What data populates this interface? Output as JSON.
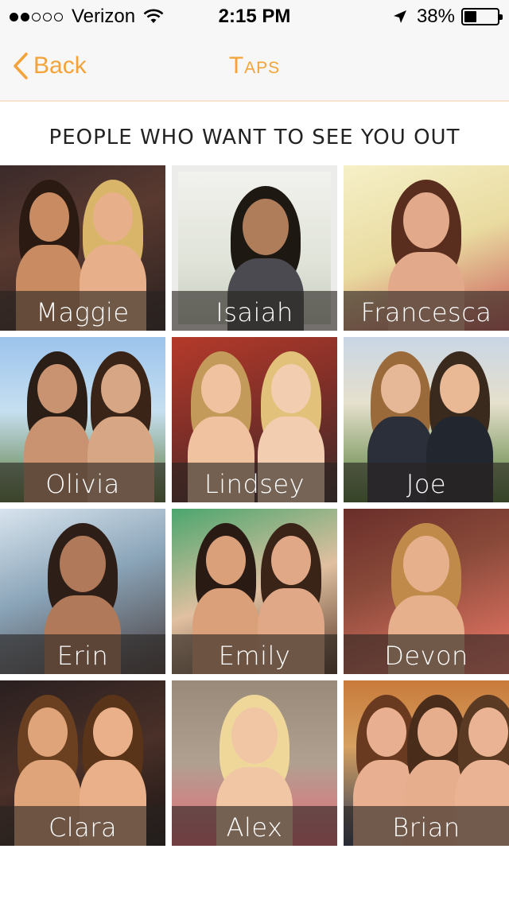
{
  "status_bar": {
    "carrier": "Verizon",
    "signal_bars_filled": 2,
    "signal_bars_total": 5,
    "time": "2:15 PM",
    "battery_percent": "38%",
    "battery_level": 0.38
  },
  "nav": {
    "back_label": "Back",
    "title": "Taps",
    "accent_color": "#f3a339"
  },
  "section": {
    "heading": "PEOPLE WHO WANT TO SEE YOU OUT"
  },
  "people": [
    {
      "name": "Maggie"
    },
    {
      "name": "Isaiah"
    },
    {
      "name": "Francesca"
    },
    {
      "name": "Olivia"
    },
    {
      "name": "Lindsey"
    },
    {
      "name": "Joe"
    },
    {
      "name": "Erin"
    },
    {
      "name": "Emily"
    },
    {
      "name": "Devon"
    },
    {
      "name": "Clara"
    },
    {
      "name": "Alex"
    },
    {
      "name": "Brian"
    }
  ]
}
